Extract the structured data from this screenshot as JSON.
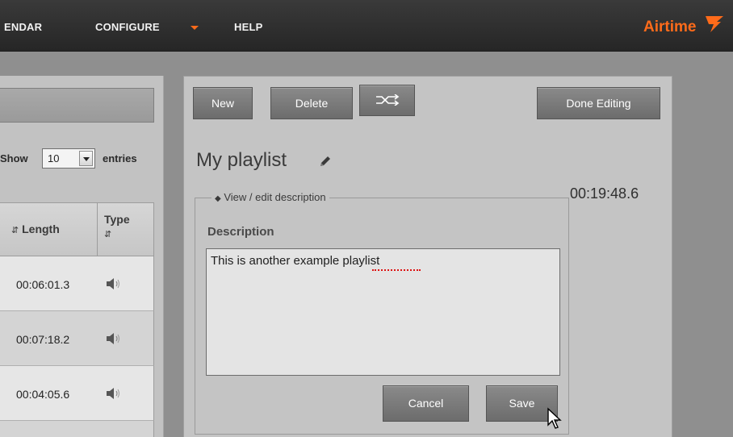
{
  "nav": {
    "calendar": "ENDAR",
    "configure": "CONFIGURE",
    "help": "HELP",
    "brand": "Airtime",
    "accent_color": "#ff6b1a"
  },
  "library": {
    "show_label": "Show",
    "page_size": "10",
    "entries_label": "entries",
    "columns": [
      "Length",
      "Type"
    ],
    "rows": [
      {
        "length": "00:06:01.3",
        "type_icon": "speaker-icon"
      },
      {
        "length": "00:07:18.2",
        "type_icon": "speaker-icon"
      },
      {
        "length": "00:04:05.6",
        "type_icon": "speaker-icon"
      }
    ]
  },
  "playlist": {
    "buttons": {
      "new": "New",
      "delete": "Delete",
      "shuffle_icon": "shuffle-icon",
      "done": "Done Editing"
    },
    "title": "My playlist",
    "duration": "00:19:48.6",
    "description_toggle": "View / edit description",
    "description_label": "Description",
    "description_value": "This is another example playlist",
    "cancel": "Cancel",
    "save": "Save"
  }
}
